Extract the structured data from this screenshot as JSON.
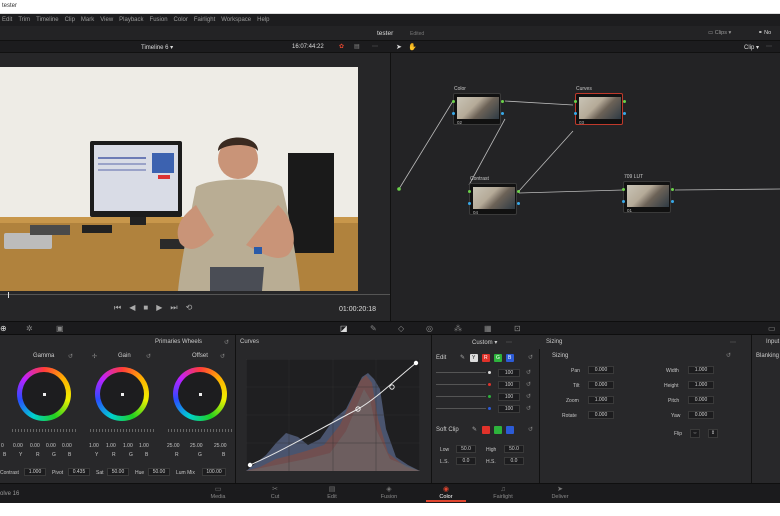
{
  "window_title": "tester",
  "menu": [
    "Edit",
    "Trim",
    "Timeline",
    "Clip",
    "Mark",
    "View",
    "Playback",
    "Fusion",
    "Color",
    "Fairlight",
    "Workspace",
    "Help"
  ],
  "project": {
    "name": "tester",
    "status": "Edited"
  },
  "clips_label": "Clips",
  "nodes_label": "No",
  "viewer": {
    "timeline": "Timeline 6",
    "timecode_top": "16:07:44:22",
    "timecode": "01:00:20:18"
  },
  "node_editor": {
    "mode": "Clip"
  },
  "nodes": [
    {
      "label": "Color",
      "num": "02"
    },
    {
      "label": "Curves",
      "num": "03"
    },
    {
      "label": "Contrast",
      "num": "04"
    },
    {
      "label": "709 LUT",
      "num": "01"
    }
  ],
  "primaries": {
    "title": "Primaries Wheels",
    "wheels": [
      {
        "name": "Gamma",
        "values": [
          "0.00",
          "0.00",
          "0.00",
          "0.00"
        ],
        "channels": [
          "Y",
          "R",
          "G",
          "B"
        ],
        "lead": [
          "0",
          "B"
        ]
      },
      {
        "name": "Gain",
        "values": [
          "1.00",
          "1.00",
          "1.00",
          "1.00"
        ],
        "channels": [
          "Y",
          "R",
          "G",
          "B"
        ]
      },
      {
        "name": "Offset",
        "values": [
          "25.00",
          "25.00",
          "25.00"
        ],
        "channels": [
          "R",
          "G",
          "B"
        ]
      }
    ],
    "footer": {
      "contrast_label": "Contrast",
      "contrast": "1.000",
      "pivot_label": "Pivot",
      "pivot": "0.435",
      "sat_label": "Sat",
      "sat": "50.00",
      "hue_label": "Hue",
      "hue": "50.00",
      "lummix_label": "Lum Mix",
      "lummix": "100.00"
    }
  },
  "curves": {
    "title": "Curves",
    "mode": "Custom"
  },
  "edit": {
    "title": "Edit",
    "channels": [
      "Y",
      "R",
      "G",
      "B"
    ],
    "values": [
      "100",
      "100",
      "100",
      "100"
    ],
    "softclip_title": "Soft Clip",
    "low_label": "Low",
    "low": "50.0",
    "high_label": "High",
    "high": "50.0",
    "ls_label": "L.S.",
    "ls": "0.0",
    "hs_label": "H.S.",
    "hs": "0.0"
  },
  "sizing": {
    "title": "Sizing",
    "section": "Sizing",
    "left": [
      {
        "label": "Pan",
        "value": "0.000"
      },
      {
        "label": "Tilt",
        "value": "0.000"
      },
      {
        "label": "Zoom",
        "value": "1.000"
      },
      {
        "label": "Rotate",
        "value": "0.000"
      }
    ],
    "right": [
      {
        "label": "Width",
        "value": "1.000"
      },
      {
        "label": "Height",
        "value": "1.000"
      },
      {
        "label": "Pitch",
        "value": "0.000"
      },
      {
        "label": "Yaw",
        "value": "0.000"
      }
    ],
    "flip_label": "Flip"
  },
  "input_panel": {
    "title": "Input",
    "section": "Blanking"
  },
  "app_name": "olve 16",
  "pages": [
    {
      "name": "Media",
      "icon": "▭"
    },
    {
      "name": "Cut",
      "icon": "✂"
    },
    {
      "name": "Edit",
      "icon": "▤"
    },
    {
      "name": "Fusion",
      "icon": "◈"
    },
    {
      "name": "Color",
      "icon": "◉"
    },
    {
      "name": "Fairlight",
      "icon": "♫"
    },
    {
      "name": "Deliver",
      "icon": "➤"
    }
  ],
  "active_page": "Color",
  "colors": {
    "accent": "#e0452f",
    "panel": "#28282a",
    "chrome": "#1b1b1d"
  }
}
